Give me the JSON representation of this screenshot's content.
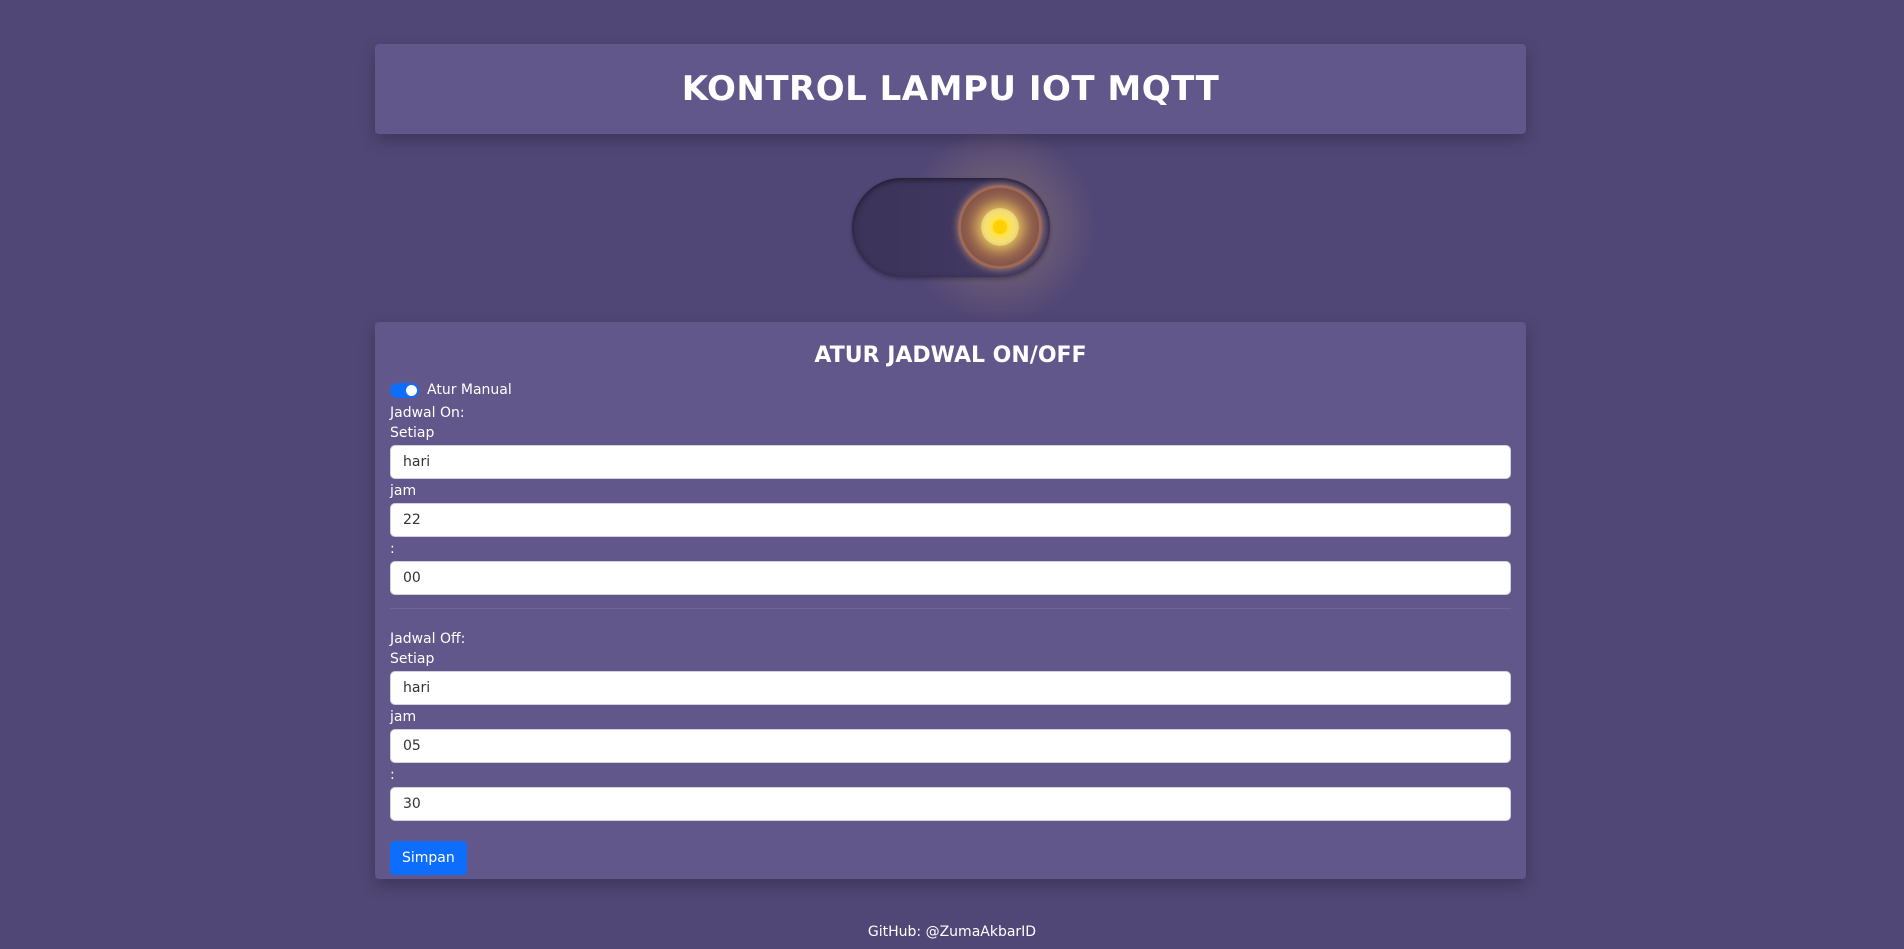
{
  "header": {
    "title": "KONTROL LAMPU IOT MQTT"
  },
  "lamp": {
    "state": "on",
    "icon": "light-bulb-icon"
  },
  "schedule": {
    "title": "ATUR JADWAL ON/OFF",
    "manual_label": "Atur Manual",
    "manual_enabled": true,
    "on": {
      "title": "Jadwal On:",
      "every_label": "Setiap",
      "every_value": "hari",
      "hour_label": "jam",
      "hour_value": "22",
      "sep_label": ":",
      "minute_value": "00"
    },
    "off": {
      "title": "Jadwal Off:",
      "every_label": "Setiap",
      "every_value": "hari",
      "hour_label": "jam",
      "hour_value": "05",
      "sep_label": ":",
      "minute_value": "30"
    },
    "save_label": "Simpan"
  },
  "footer": {
    "text": "GitHub: @ZumaAkbarID"
  },
  "colors": {
    "background": "#514776",
    "card": "#61578a",
    "accent": "#0d6efd"
  }
}
